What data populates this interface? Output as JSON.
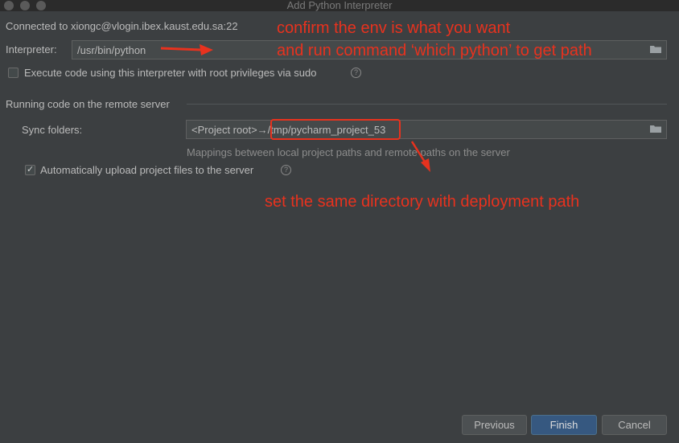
{
  "window": {
    "title": "Add Python Interpreter"
  },
  "connection": {
    "text": "Connected to xiongc@vlogin.ibex.kaust.edu.sa:22"
  },
  "interpreter": {
    "label": "Interpreter:",
    "value": "/usr/bin/python",
    "folder_icon": "folder-icon"
  },
  "sudo_option": {
    "label": "Execute code using this interpreter with root privileges via sudo",
    "checked": false,
    "help_icon": "help-icon",
    "help_glyph": "?"
  },
  "remote_section": {
    "title": "Running code on the remote server",
    "sync_label": "Sync folders:",
    "sync_value_local": "<Project root>",
    "sync_arrow": "→",
    "sync_value_remote": "/tmp/pycharm_project_53",
    "hint": "Mappings between local project paths and remote paths on the server",
    "auto_upload_label": "Automatically upload project files to the server",
    "auto_upload_checked": true,
    "checkmark": "✓",
    "help_glyph": "?"
  },
  "annotations": {
    "line1": "confirm the env is what you want",
    "line2": "and run command ‘which python’ to get path",
    "line3": "set the same directory with deployment path",
    "color": "#e8321e"
  },
  "buttons": {
    "previous": "Previous",
    "finish": "Finish",
    "cancel": "Cancel"
  }
}
